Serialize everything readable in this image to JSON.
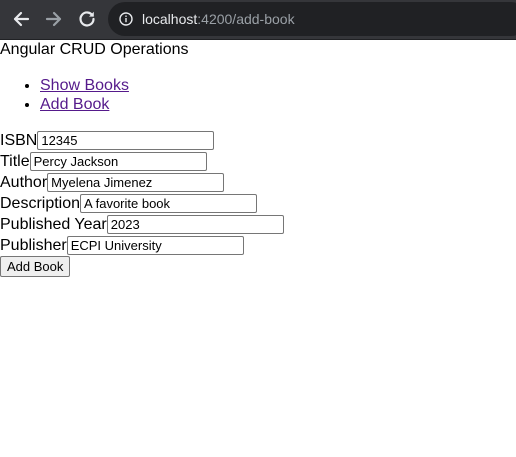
{
  "browser": {
    "url_host": "localhost",
    "url_rest": ":4200/add-book"
  },
  "app": {
    "title": "Angular CRUD Operations"
  },
  "nav": {
    "items": [
      {
        "label": "Show Books"
      },
      {
        "label": "Add Book"
      }
    ]
  },
  "form": {
    "fields": [
      {
        "label": "ISBN",
        "value": "12345"
      },
      {
        "label": "Title",
        "value": "Percy Jackson"
      },
      {
        "label": "Author",
        "value": "Myelena Jimenez"
      },
      {
        "label": "Description",
        "value": "A favorite book"
      },
      {
        "label": "Published Year",
        "value": "2023"
      },
      {
        "label": "Publisher",
        "value": "ECPI University"
      }
    ],
    "submit_label": "Add Book"
  },
  "colors": {
    "toolbar_bg": "#35363a",
    "omnibox_bg": "#202124",
    "link_visited": "#551a8b"
  },
  "icons": {
    "back": "arrow-left-icon",
    "forward": "arrow-right-icon",
    "reload": "reload-icon",
    "site_info": "info-icon"
  }
}
